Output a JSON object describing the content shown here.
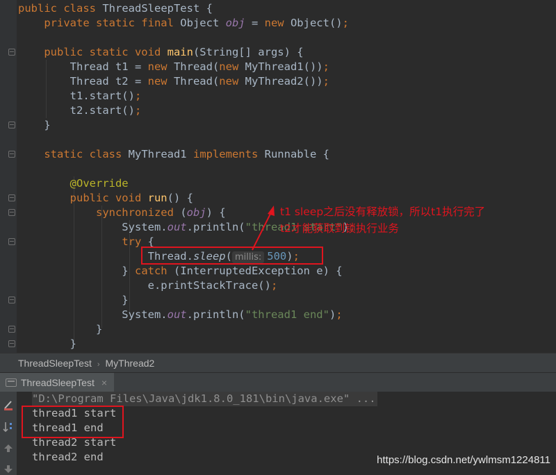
{
  "editor": {
    "lines": [
      [
        "public class ThreadSleepTest {"
      ],
      [
        "    private static final Object obj = new Object();"
      ],
      [
        ""
      ],
      [
        "    public static void main(String[] args) {"
      ],
      [
        "        Thread t1 = new Thread(new MyThread1());"
      ],
      [
        "        Thread t2 = new Thread(new MyThread2());"
      ],
      [
        "        t1.start();"
      ],
      [
        "        t2.start();"
      ],
      [
        "    }"
      ],
      [
        ""
      ],
      [
        "    static class MyThread1 implements Runnable {"
      ],
      [
        ""
      ],
      [
        "        @Override"
      ],
      [
        "        public void run() {"
      ],
      [
        "            synchronized (obj) {"
      ],
      [
        "                System.out.println(\"thread1 start\");"
      ],
      [
        "                try {"
      ],
      [
        "                    Thread.sleep(millis: 500);"
      ],
      [
        "                } catch (InterruptedException e) {"
      ],
      [
        "                    e.printStackTrace();"
      ],
      [
        "                }"
      ],
      [
        "                System.out.println(\"thread1 end\");"
      ],
      [
        "            }"
      ],
      [
        "        }"
      ]
    ],
    "parameter_hint": "millis:",
    "annotation_lines": [
      "t1 sleep之后没有释放锁，所以t1执行完了",
      "t2才能获取到锁执行业务"
    ]
  },
  "breadcrumb": {
    "items": [
      "ThreadSleepTest",
      "MyThread2"
    ],
    "separator": "›"
  },
  "run_panel": {
    "tab_label": "ThreadSleepTest",
    "close_label": "×"
  },
  "console": {
    "lines": [
      "\"D:\\Program Files\\Java\\jdk1.8.0_181\\bin\\java.exe\" ...",
      "thread1 start",
      "thread1 end",
      "thread2 start",
      "thread2 end"
    ]
  },
  "watermark": "https://blog.csdn.net/ywlmsm1224811",
  "icons": {
    "fold": "fold-icon",
    "rerun": "rerun-icon",
    "scroll_end": "scroll-to-end-icon",
    "up": "arrow-up-icon",
    "down": "arrow-down-icon",
    "run_tab": "console-tab-icon"
  },
  "colors": {
    "keyword": "#cc7832",
    "function": "#ffc66d",
    "string": "#6a8759",
    "annotation": "#bbb529",
    "field": "#9876aa",
    "number": "#6897bb",
    "highlight": "#e0141e"
  }
}
